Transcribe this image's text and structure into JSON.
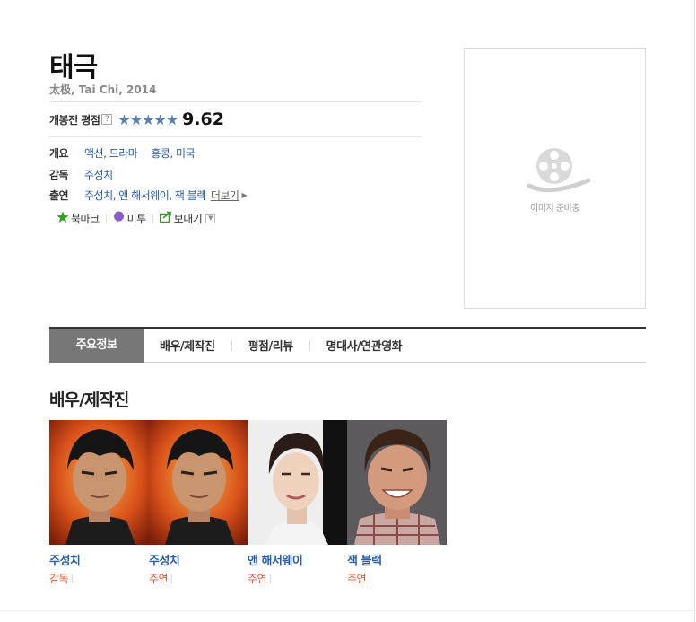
{
  "movie": {
    "title": "태극",
    "subtitle": "太极, Tai Chi, 2014"
  },
  "rating": {
    "label": "개봉전 평점",
    "help_icon": "?",
    "stars": "★★★★★",
    "score": "9.62"
  },
  "info": {
    "genre_label": "개요",
    "genres": "액션, 드라마",
    "countries": "홍콩, 미국",
    "director_label": "감독",
    "director": "주성치",
    "cast_label": "출연",
    "cast_list": "주성치, 앤 해서웨이, 잭 블랙",
    "more_label": "더보기"
  },
  "actions": {
    "bookmark": "북마크",
    "metoo": "미투",
    "share": "보내기"
  },
  "poster": {
    "placeholder_text": "이미지 준비중"
  },
  "tabs": [
    {
      "label": "주요정보"
    },
    {
      "label": "배우/제작진"
    },
    {
      "label": "평점/리뷰"
    },
    {
      "label": "명대사/연관영화"
    }
  ],
  "section": {
    "title": "배우/제작진"
  },
  "cast": [
    {
      "name": "주성치",
      "role": "감독"
    },
    {
      "name": "주성치",
      "role": "주연"
    },
    {
      "name": "앤 해서웨이",
      "role": "주연"
    },
    {
      "name": "잭 블랙",
      "role": "주연"
    }
  ],
  "colors": {
    "link": "#2a5ea8",
    "role": "#e05a3a",
    "stars": "#5a7fa8",
    "active_tab": "#777777"
  }
}
